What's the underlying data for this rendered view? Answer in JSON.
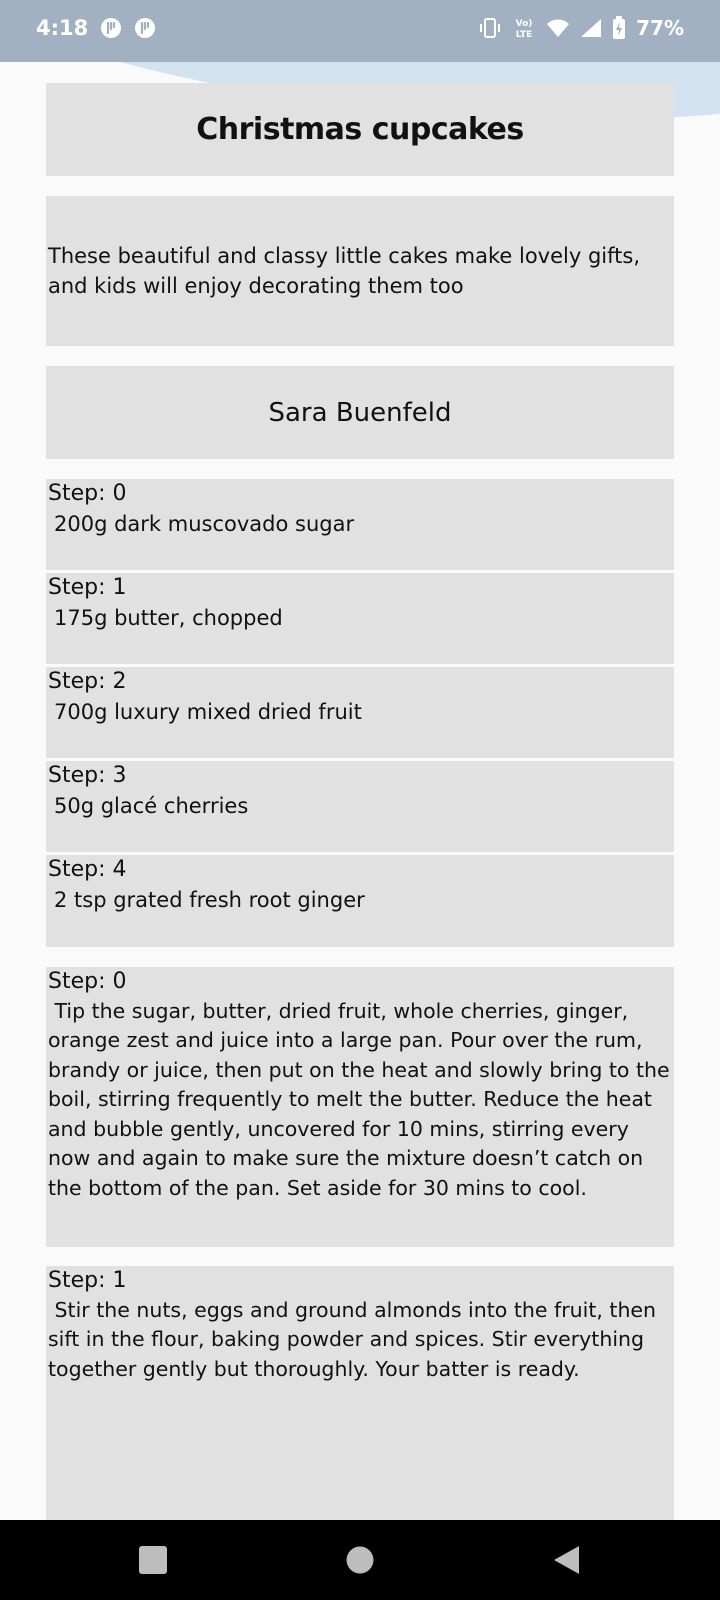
{
  "status_bar": {
    "time": "4:18",
    "battery": "77%",
    "network_label": "Vo LTE",
    "icons": [
      "notification-icon",
      "notification-icon",
      "vibrate-icon",
      "volte-icon",
      "wifi-icon",
      "cell-signal-icon",
      "battery-charging-icon"
    ]
  },
  "recipe": {
    "title": "Christmas cupcakes",
    "description": "These beautiful and classy little cakes make lovely gifts, and kids will enjoy decorating them too",
    "author": "Sara Buenfeld"
  },
  "ingredients": [
    {
      "label": "Step: 0",
      "text": "200g dark muscovado sugar"
    },
    {
      "label": "Step: 1",
      "text": "175g butter, chopped"
    },
    {
      "label": "Step: 2",
      "text": "700g luxury mixed dried fruit"
    },
    {
      "label": "Step: 3",
      "text": "50g glacé cherries"
    },
    {
      "label": "Step: 4",
      "text": "2 tsp grated fresh root ginger"
    }
  ],
  "method": [
    {
      "label": "Step: 0",
      "text": "Tip the sugar, butter, dried fruit, whole cherries, ginger, orange zest and juice into a large pan. Pour over the rum, brandy or juice, then put on the heat and slowly bring to the boil, stirring frequently to melt the butter. Reduce the heat and bubble gently, uncovered for 10 mins, stirring every now and again to make sure the mixture doesn’t catch on the bottom of the pan. Set aside for 30 mins to cool."
    },
    {
      "label": "Step: 1",
      "text": "Stir the nuts, eggs and ground almonds into the fruit, then sift in the flour, baking powder and spices. Stir everything together gently but thoroughly. Your batter is ready."
    }
  ],
  "nav_bar": {
    "icons": [
      "recents-square-icon",
      "home-circle-icon",
      "back-triangle-icon"
    ]
  },
  "colors": {
    "status_bar": "#a2b1c1",
    "wave": "#d4e3f2",
    "card": "#e1e1e1",
    "background": "#fafafa"
  }
}
